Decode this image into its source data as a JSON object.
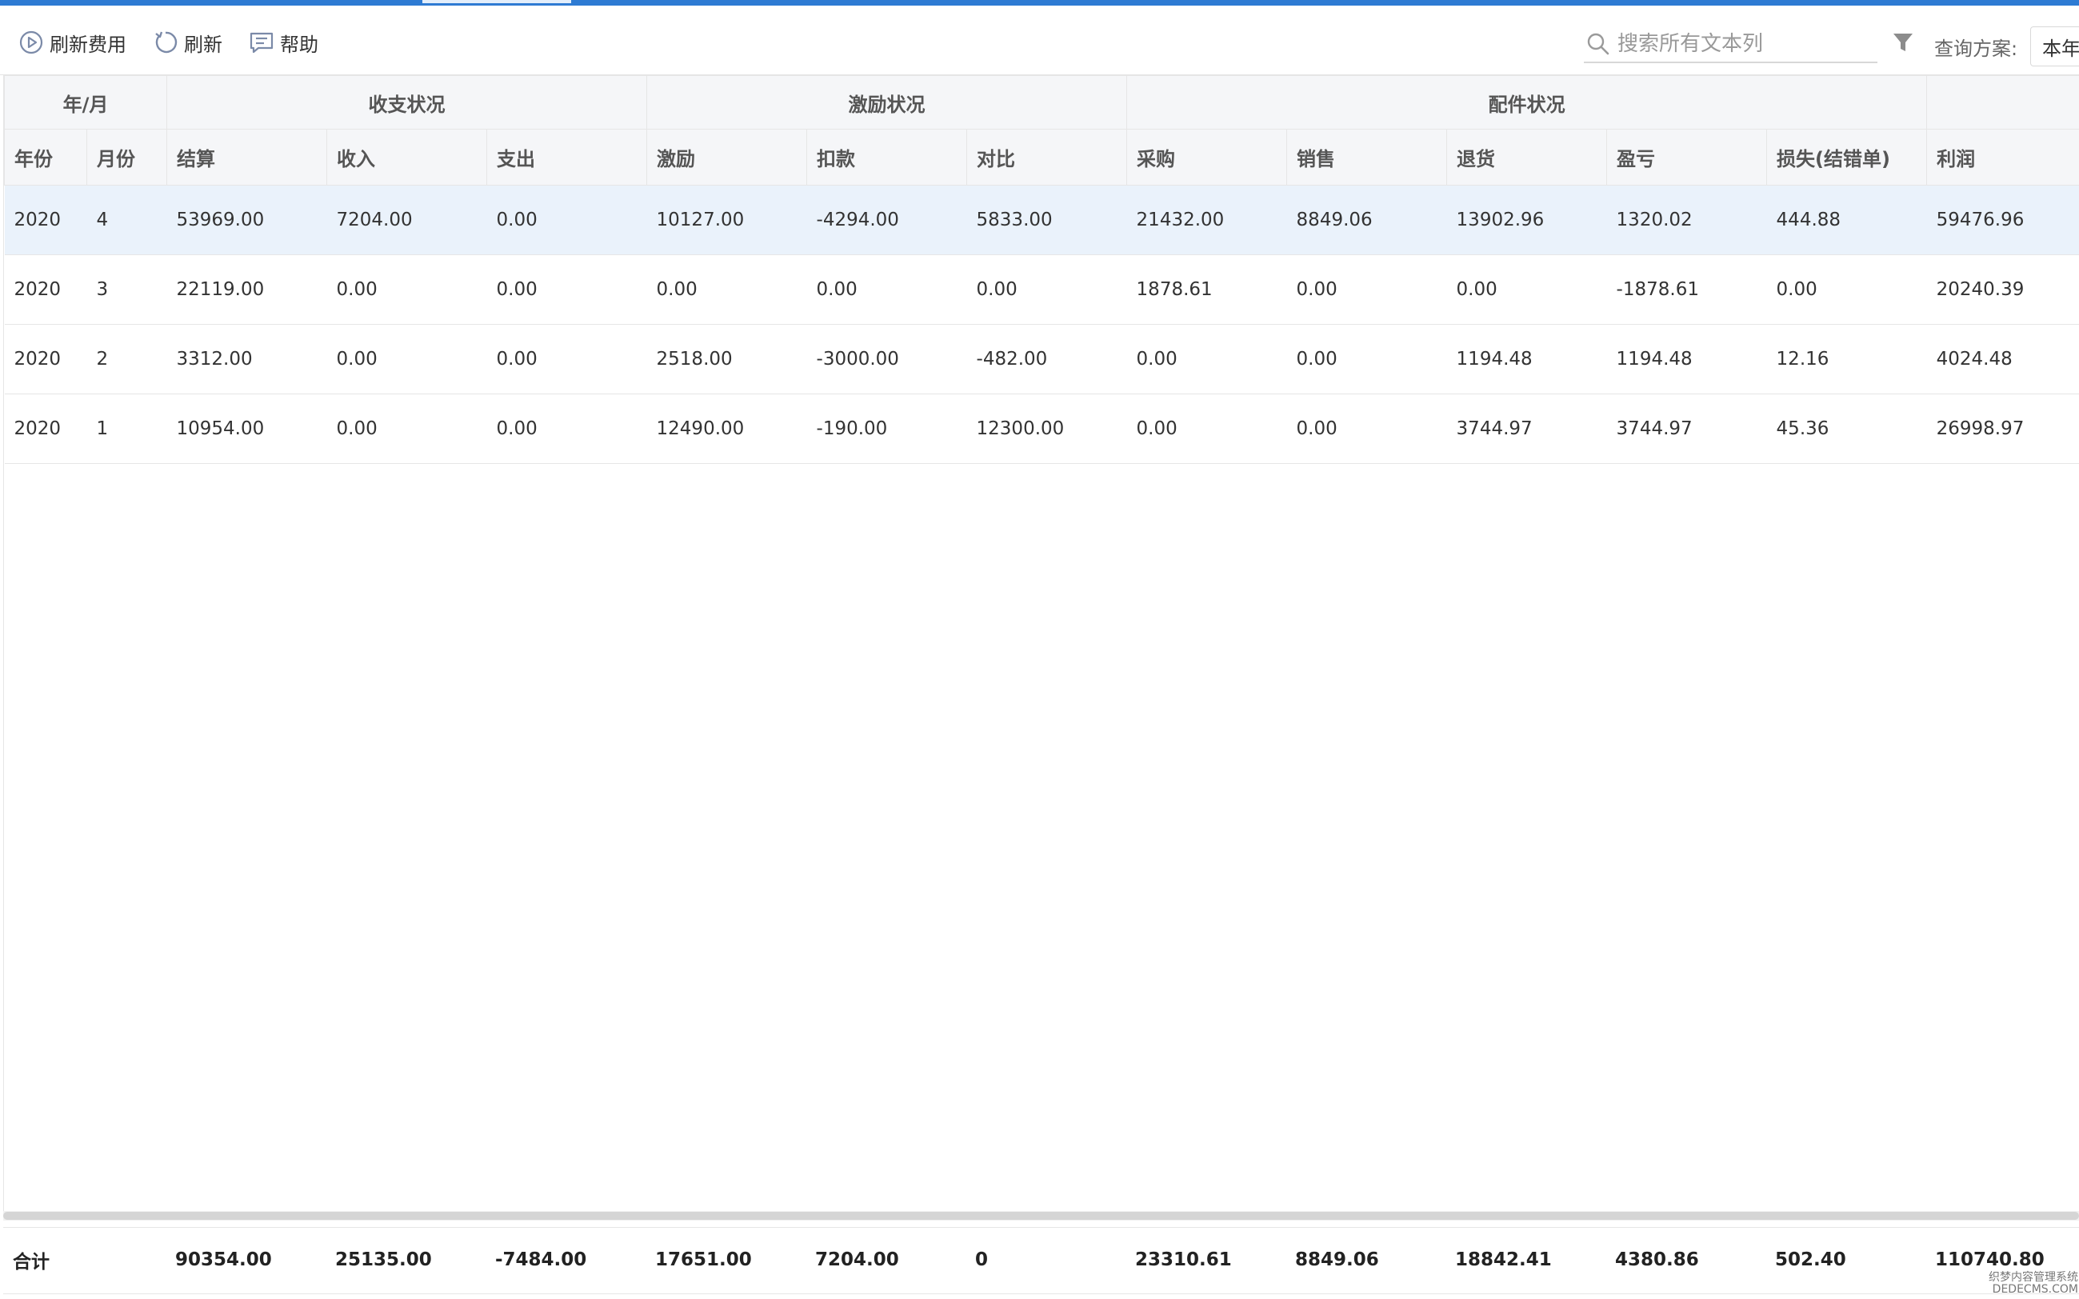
{
  "toolbar": {
    "refresh_fee_label": "刷新费用",
    "refresh_label": "刷新",
    "help_label": "帮助",
    "search_placeholder": "搜索所有文本列",
    "plan_label": "查询方案:",
    "plan_value": "本年"
  },
  "colors": {
    "accent": "#2e7bd3",
    "selected_row": "#eaf2fb",
    "header_bg": "#f5f6f8",
    "border": "#e6e6e6"
  },
  "table": {
    "groups": [
      "年/月",
      "收支状况",
      "激励状况",
      "配件状况",
      ""
    ],
    "columns": [
      "年份",
      "月份",
      "结算",
      "收入",
      "支出",
      "激励",
      "扣款",
      "对比",
      "采购",
      "销售",
      "退货",
      "盈亏",
      "损失(结错单)",
      "利润"
    ],
    "rows": [
      [
        "2020",
        "4",
        "53969.00",
        "7204.00",
        "0.00",
        "10127.00",
        "-4294.00",
        "5833.00",
        "21432.00",
        "8849.06",
        "13902.96",
        "1320.02",
        "444.88",
        "59476.96"
      ],
      [
        "2020",
        "3",
        "22119.00",
        "0.00",
        "0.00",
        "0.00",
        "0.00",
        "0.00",
        "1878.61",
        "0.00",
        "0.00",
        "-1878.61",
        "0.00",
        "20240.39"
      ],
      [
        "2020",
        "2",
        "3312.00",
        "0.00",
        "0.00",
        "2518.00",
        "-3000.00",
        "-482.00",
        "0.00",
        "0.00",
        "1194.48",
        "1194.48",
        "12.16",
        "4024.48"
      ],
      [
        "2020",
        "1",
        "10954.00",
        "0.00",
        "0.00",
        "12490.00",
        "-190.00",
        "12300.00",
        "0.00",
        "0.00",
        "3744.97",
        "3744.97",
        "45.36",
        "26998.97"
      ]
    ],
    "selected_row": 0
  },
  "footer": {
    "label": "合计",
    "values": [
      "90354.00",
      "25135.00",
      "-7484.00",
      "17651.00",
      "7204.00",
      "0",
      "23310.61",
      "8849.06",
      "18842.41",
      "4380.86",
      "502.40",
      "110740.80"
    ]
  },
  "watermark": {
    "line1": "织梦内容管理系统",
    "line2": "DEDECMS.COM"
  }
}
